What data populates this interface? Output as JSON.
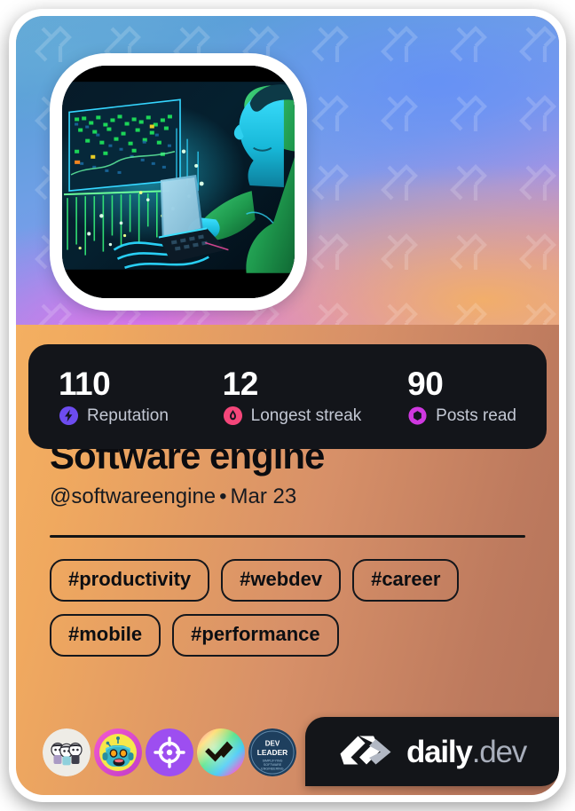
{
  "card": {
    "type": "devcard",
    "theme": {
      "card_border": "#ffffff",
      "body_gradient_from": "#f7b563",
      "body_gradient_to": "#b4735a",
      "stats_bar_bg": "#13151a",
      "brand_bg": "#131519",
      "text_dark": "#0b0c10"
    }
  },
  "cover": {
    "watermark_icon": "dailydev-logo-watermark",
    "gradient_stops": [
      "#63a8d8",
      "#7c9ceb",
      "#c58fd1",
      "#e270ec",
      "#f5b062"
    ],
    "avatar": {
      "icon": "user-avatar-image",
      "alt": "Neon illustration of a developer working on a laptop with data dashboards"
    }
  },
  "stats": [
    {
      "value": "110",
      "label": "Reputation",
      "icon": "reputation-bolt-icon",
      "color": "#6d4cf0"
    },
    {
      "value": "12",
      "label": "Longest streak",
      "icon": "streak-flame-icon",
      "color": "#f4467a"
    },
    {
      "value": "90",
      "label": "Posts read",
      "icon": "posts-read-ring-icon",
      "color": "#cf38e0"
    }
  ],
  "profile": {
    "name": "Software engine",
    "handle": "@softwareengine",
    "separator": "•",
    "joined": "Mar 23"
  },
  "tags": [
    "#productivity",
    "#webdev",
    "#career",
    "#mobile",
    "#performance"
  ],
  "badges": [
    {
      "name": "community-picks-badge",
      "icon": "three-characters-icon"
    },
    {
      "name": "robot-badge",
      "icon": "robot-head-icon"
    },
    {
      "name": "target-badge",
      "icon": "crosshair-target-icon"
    },
    {
      "name": "rainbow-check-badge",
      "icon": "rainbow-checkmark-icon"
    },
    {
      "name": "dev-leader-badge",
      "icon": "dev-leader-seal-icon",
      "line1": "DEV",
      "line2": "LEADER",
      "line3": "SIMPLIFYING SOFTWARE ENGINEERING"
    }
  ],
  "brand": {
    "mark_icon": "dailydev-chevron-logo",
    "name": "daily",
    "suffix": ".dev"
  }
}
